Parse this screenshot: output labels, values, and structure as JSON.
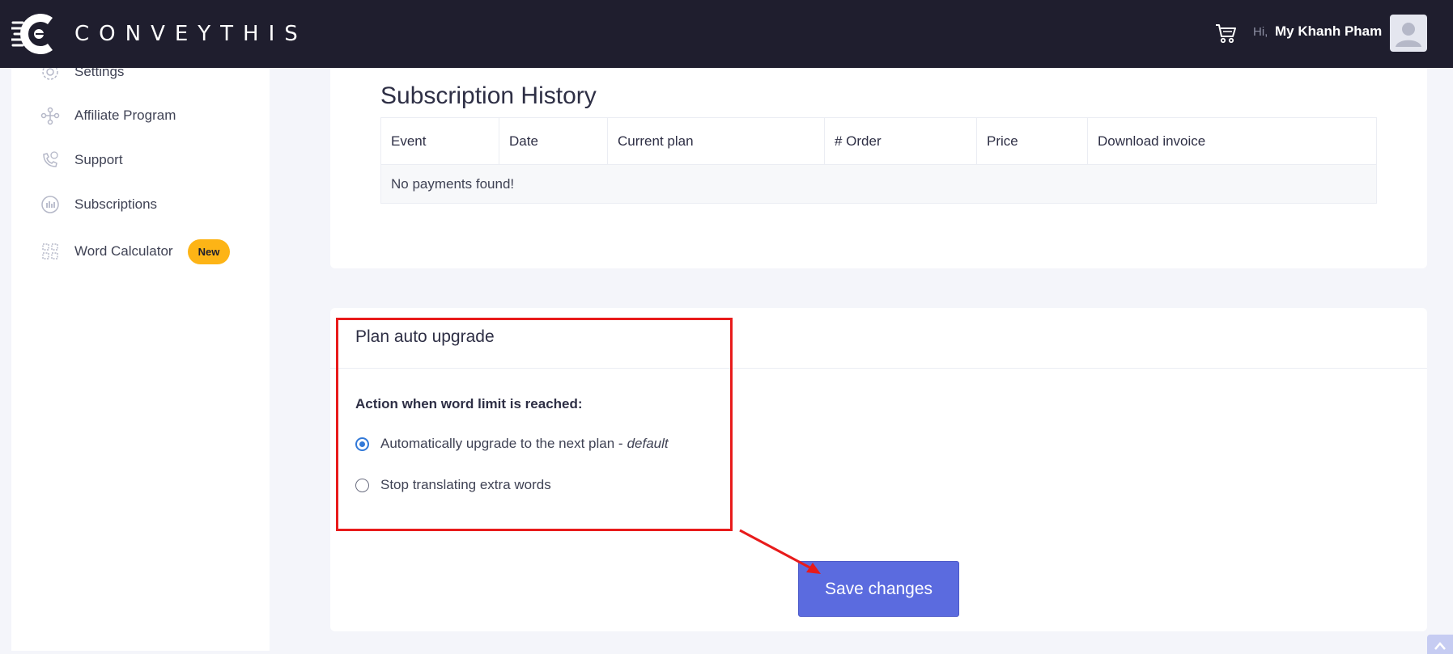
{
  "header": {
    "brand": "CONVEYTHIS",
    "greeting_prefix": "Hi,",
    "user_name": "My Khanh Pham"
  },
  "sidebar": {
    "items": [
      {
        "label": "Settings",
        "icon": "gear-icon"
      },
      {
        "label": "Affiliate Program",
        "icon": "network-icon"
      },
      {
        "label": "Support",
        "icon": "phone-question-icon"
      },
      {
        "label": "Subscriptions",
        "icon": "bar-chart-icon"
      },
      {
        "label": "Word Calculator",
        "icon": "calculator-icon",
        "badge": "New"
      }
    ]
  },
  "subscription_history": {
    "title": "Subscription History",
    "columns": [
      "Event",
      "Date",
      "Current plan",
      "# Order",
      "Price",
      "Download invoice"
    ],
    "empty_message": "No payments found!"
  },
  "auto_upgrade": {
    "title": "Plan auto upgrade",
    "action_label": "Action when word limit is reached:",
    "options": [
      {
        "label": "Automatically upgrade to the next plan -",
        "suffix": "default",
        "checked": true
      },
      {
        "label": "Stop translating extra words",
        "checked": false
      }
    ],
    "save_label": "Save changes"
  },
  "colors": {
    "topbar": "#1f1e2e",
    "accent": "#5b6bdf",
    "badge": "#fdb416",
    "annotation": "#e81b1b"
  }
}
